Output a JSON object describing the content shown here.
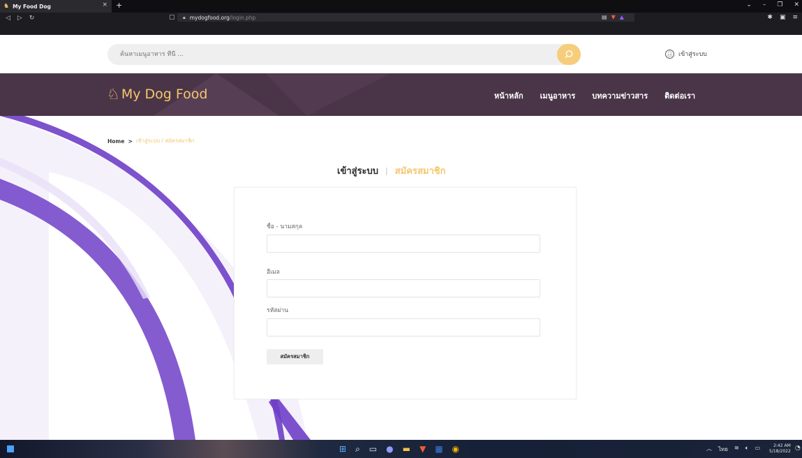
{
  "browser": {
    "tab_title": "My Food Dog",
    "tab_close": "×",
    "new_tab": "+",
    "url_host": "mydogfood.org",
    "url_path": "/login.php"
  },
  "site": {
    "search_placeholder": "ค้นหาเมนูอาหาร ที่นี่ ...",
    "login_link": "เข้าสู่ระบบ",
    "logo_text": "My Dog Food",
    "menu": [
      "หน้าหลัก",
      "เมนูอาหาร",
      "บทความข่าวสาร",
      "ติดต่อเรา"
    ]
  },
  "breadcrumb": {
    "home": "Home",
    "sep": ">",
    "current": "เข้าสู่ระบบ / สมัครสมาชิก"
  },
  "switcher": {
    "login": "เข้าสู่ระบบ",
    "divider": "|",
    "register": "สมัครสมาชิก"
  },
  "form": {
    "name_label": "ชื่อ - นามสกุล",
    "email_label": "อีเมล",
    "password_label": "รหัสผ่าน",
    "submit_label": "สมัครสมาชิก"
  },
  "taskbar": {
    "time": "2:42 AM",
    "date": "5/18/2022",
    "lang": "ไทย"
  },
  "colors": {
    "accent": "#f6c76b",
    "nav_bg": "#4a3548",
    "deco": "#6f3fc8"
  }
}
